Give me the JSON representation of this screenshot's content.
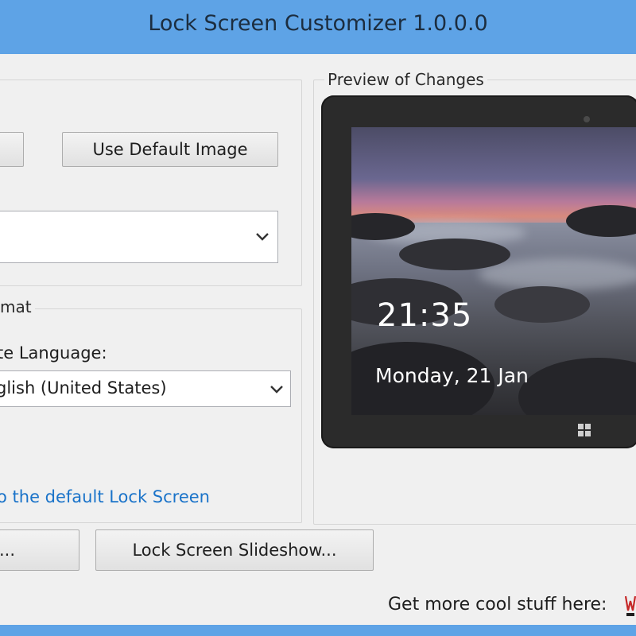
{
  "window": {
    "title": "Lock Screen Customizer 1.0.0.0"
  },
  "image_group": {
    "default_button": "Use Default Image"
  },
  "format_group": {
    "label": "mat",
    "language_label": "te Language:",
    "language_value": "glish (United States)"
  },
  "preview": {
    "label": "Preview of Changes",
    "time": "21:35",
    "date": "Monday, 21 Jan"
  },
  "restore_link": "o the default Lock Screen",
  "buttons": {
    "left_partial": "...",
    "slideshow": "Lock Screen Slideshow..."
  },
  "footer": {
    "text": "Get more cool stuff here:"
  },
  "colors": {
    "titlebar": "#5ea3e6",
    "link": "#1a73c9"
  }
}
